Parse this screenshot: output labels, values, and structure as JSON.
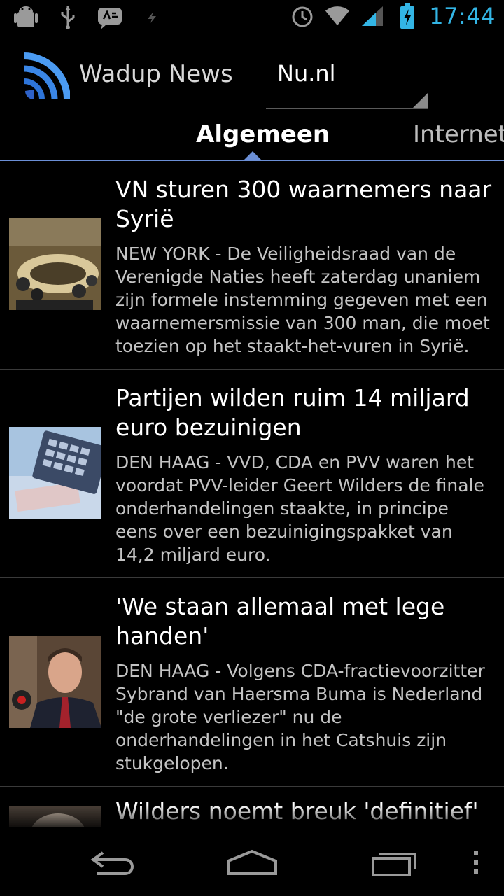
{
  "status": {
    "time": "17:44"
  },
  "header": {
    "app_title": "Wadup News",
    "source": "Nu.nl"
  },
  "tabs": [
    {
      "label": "Algemeen",
      "active": true
    },
    {
      "label": "Internet",
      "active": false
    }
  ],
  "articles": [
    {
      "title": "VN sturen 300 waarnemers naar Syrië",
      "summary": "NEW YORK - De Veiligheidsraad van de Verenigde Naties heeft zaterdag unaniem zijn formele instemming gegeven met een waarnemersmissie van 300 man, die moet toezien op het staakt-het-vuren in Syrië."
    },
    {
      "title": "Partijen wilden ruim 14 miljard euro bezuinigen",
      "summary": "DEN HAAG - VVD, CDA en PVV waren het voordat PVV-leider Geert Wilders de finale onderhandelingen staakte, in principe eens over een bezuinigingspakket van 14,2 miljard euro."
    },
    {
      "title": "'We staan allemaal met lege handen'",
      "summary": "DEN HAAG - Volgens CDA-fractievoorzitter Sybrand van Haersma Buma is Nederland \"de grote verliezer\" nu de onderhandelingen in het Catshuis zijn stukgelopen."
    },
    {
      "title": "Wilders noemt breuk 'definitief'",
      "summary": ""
    }
  ],
  "colors": {
    "accent": "#33b5e5",
    "tab_indicator": "#6b8fd6",
    "background": "#000000"
  }
}
